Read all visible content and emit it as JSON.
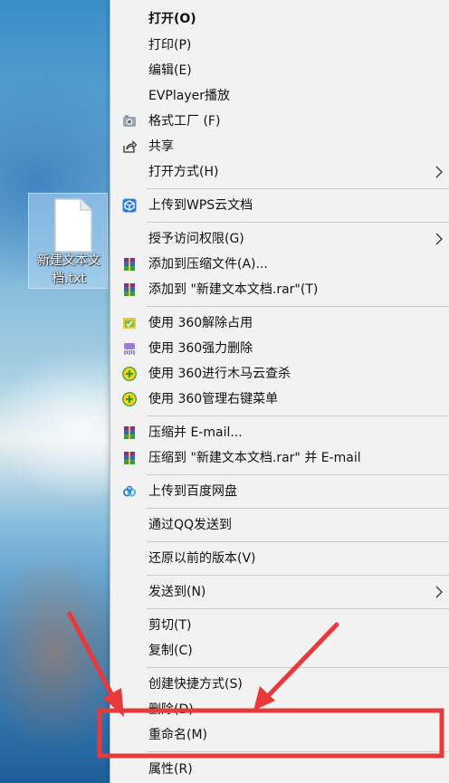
{
  "desktop_file": {
    "name": "新建文本文档.txt"
  },
  "menu": {
    "open": "打开(O)",
    "print": "打印(P)",
    "edit": "编辑(E)",
    "evplayer": "EVPlayer播放",
    "format_factory": "格式工厂 (F)",
    "share": "共享",
    "open_with": "打开方式(H)",
    "upload_wps": "上传到WPS云文档",
    "grant_access": "授予访问权限(G)",
    "add_to_archive": "添加到压缩文件(A)...",
    "add_to_rar": "添加到 \"新建文本文档.rar\"(T)",
    "unlock_360": "使用 360解除占用",
    "force_delete_360": "使用 360强力删除",
    "trojan_scan_360": "使用 360进行木马云查杀",
    "manage_menu_360": "使用 360管理右键菜单",
    "compress_email": "压缩并 E-mail...",
    "compress_rar_email": "压缩到 \"新建文本文档.rar\" 并 E-mail",
    "upload_baidu": "上传到百度网盘",
    "send_qq": "通过QQ发送到",
    "restore_versions": "还原以前的版本(V)",
    "send_to": "发送到(N)",
    "cut": "剪切(T)",
    "copy": "复制(C)",
    "create_shortcut": "创建快捷方式(S)",
    "delete": "删除(D)",
    "rename": "重命名(M)",
    "properties": "属性(R)"
  },
  "annotation": {
    "color": "#e8393b"
  }
}
